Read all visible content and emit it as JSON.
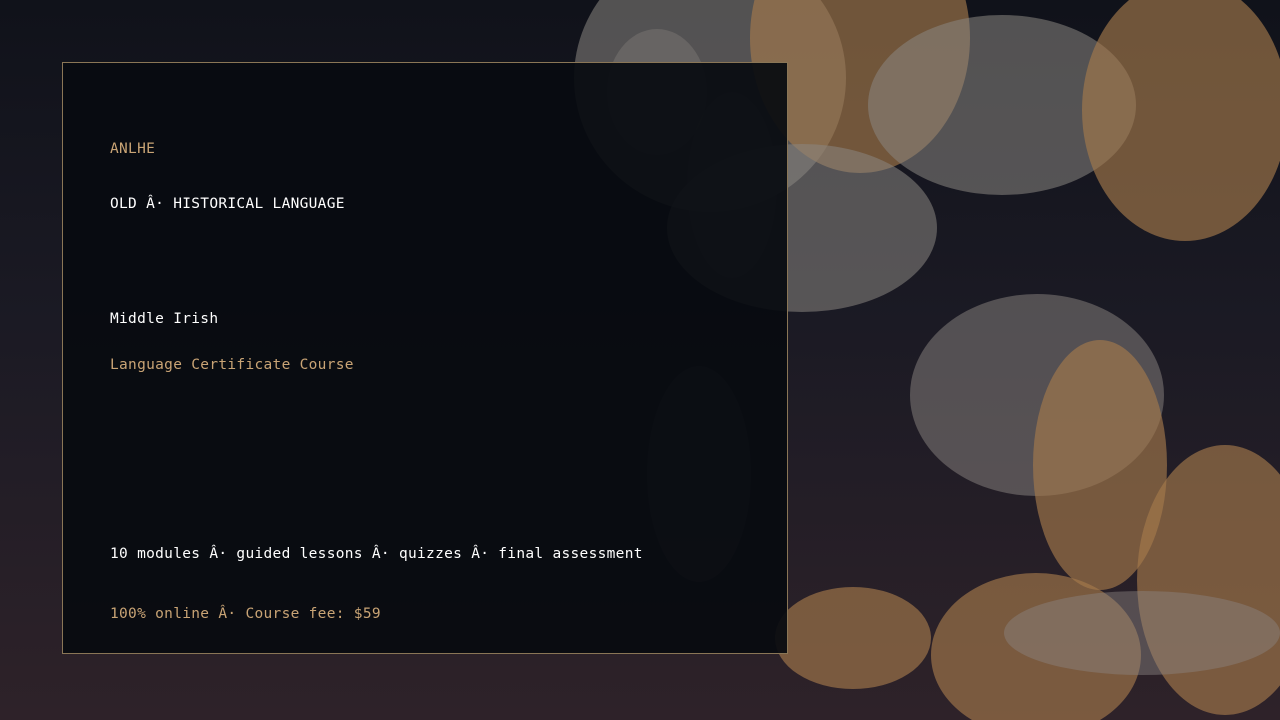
{
  "brand": "ANLHE",
  "category": "OLD Â· HISTORICAL LANGUAGE",
  "course_name": "Middle Irish",
  "subtitle": "Language Certificate Course",
  "details": "10 modules Â· guided lessons Â· quizzes Â· final assessment",
  "pricing": "100% online Â· Course fee: $59",
  "colors": {
    "accent": "#c9a475",
    "text": "#ffffff",
    "card_background": "#080b10",
    "card_border": "#8a7656",
    "bokeh_gold": "#a47a4b",
    "bokeh_grey": "#8b8682"
  }
}
